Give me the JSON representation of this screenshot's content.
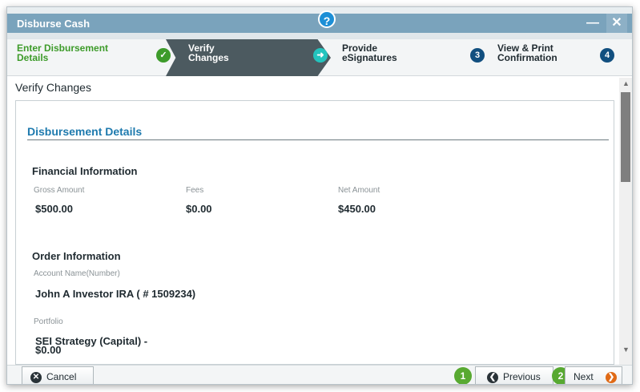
{
  "window": {
    "title": "Disburse Cash",
    "help_icon": "?",
    "minimize_icon": "—",
    "close_icon": "✕"
  },
  "steps": [
    {
      "label": "Enter Disbursement Details",
      "status": "complete"
    },
    {
      "label": "Verify Changes",
      "status": "active"
    },
    {
      "label": "Provide eSignatures",
      "number": "3"
    },
    {
      "label": "View & Print Confirmation",
      "number": "4"
    }
  ],
  "page": {
    "title": "Verify Changes",
    "section_title": "Disbursement Details"
  },
  "financial": {
    "group_title": "Financial Information",
    "gross_label": "Gross Amount",
    "gross_value": "$500.00",
    "fees_label": "Fees",
    "fees_value": "$0.00",
    "net_label": "Net Amount",
    "net_value": "$450.00"
  },
  "order": {
    "group_title": "Order Information",
    "account_label": "Account Name(Number)",
    "account_value": "John A Investor IRA ( # 1509234)",
    "portfolio_label": "Portfolio",
    "portfolio_value": "SEI Strategy (Capital) -",
    "portfolio_amount": "$0.00"
  },
  "footer": {
    "cancel": "Cancel",
    "previous": "Previous",
    "next": "Next",
    "badge_1": "1",
    "badge_2": "2"
  },
  "colors": {
    "accent": "#1e7aae",
    "complete": "#3d9b2a",
    "active": "#4c5a60",
    "next": "#e06a16"
  }
}
